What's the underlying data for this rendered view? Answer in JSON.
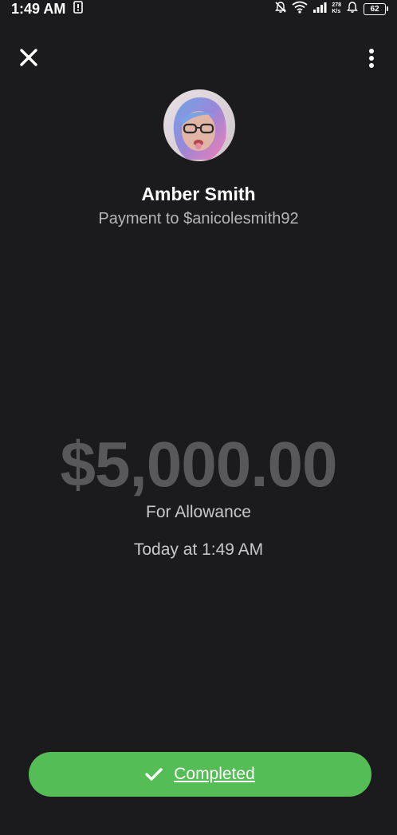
{
  "status_bar": {
    "time": "1:49 AM",
    "net_speed_value": "278",
    "net_speed_unit": "K/s",
    "battery": "62"
  },
  "header": {
    "close_icon": "close-icon",
    "more_icon": "more-vertical-icon"
  },
  "recipient": {
    "name": "Amber Smith",
    "subtitle": "Payment to $anicolesmith92"
  },
  "payment": {
    "amount": "$5,000.00",
    "note": "For Allowance",
    "timestamp": "Today at 1:49 AM"
  },
  "status_button": {
    "label": "Completed",
    "icon": "checkmark-icon",
    "color": "#54bd55"
  },
  "colors": {
    "background": "#1b1b1d",
    "amount_text": "#58585b",
    "secondary_text": "#b6b6b8"
  }
}
